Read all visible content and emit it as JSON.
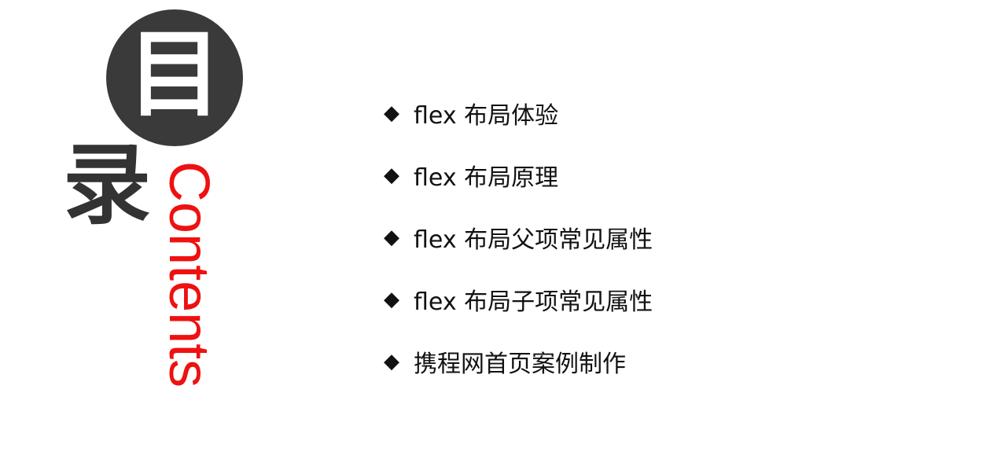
{
  "title": {
    "char1": "目",
    "char2": "录",
    "subtitle": "Contents"
  },
  "bullet_glyph": "◆",
  "items": [
    {
      "label": "flex 布局体验"
    },
    {
      "label": "flex 布局原理"
    },
    {
      "label": "flex 布局父项常见属性"
    },
    {
      "label": "flex 布局子项常见属性"
    },
    {
      "label": "携程网首页案例制作"
    }
  ],
  "colors": {
    "circle": "#3a3a3a",
    "accent": "#ee1111",
    "text": "#111111"
  }
}
